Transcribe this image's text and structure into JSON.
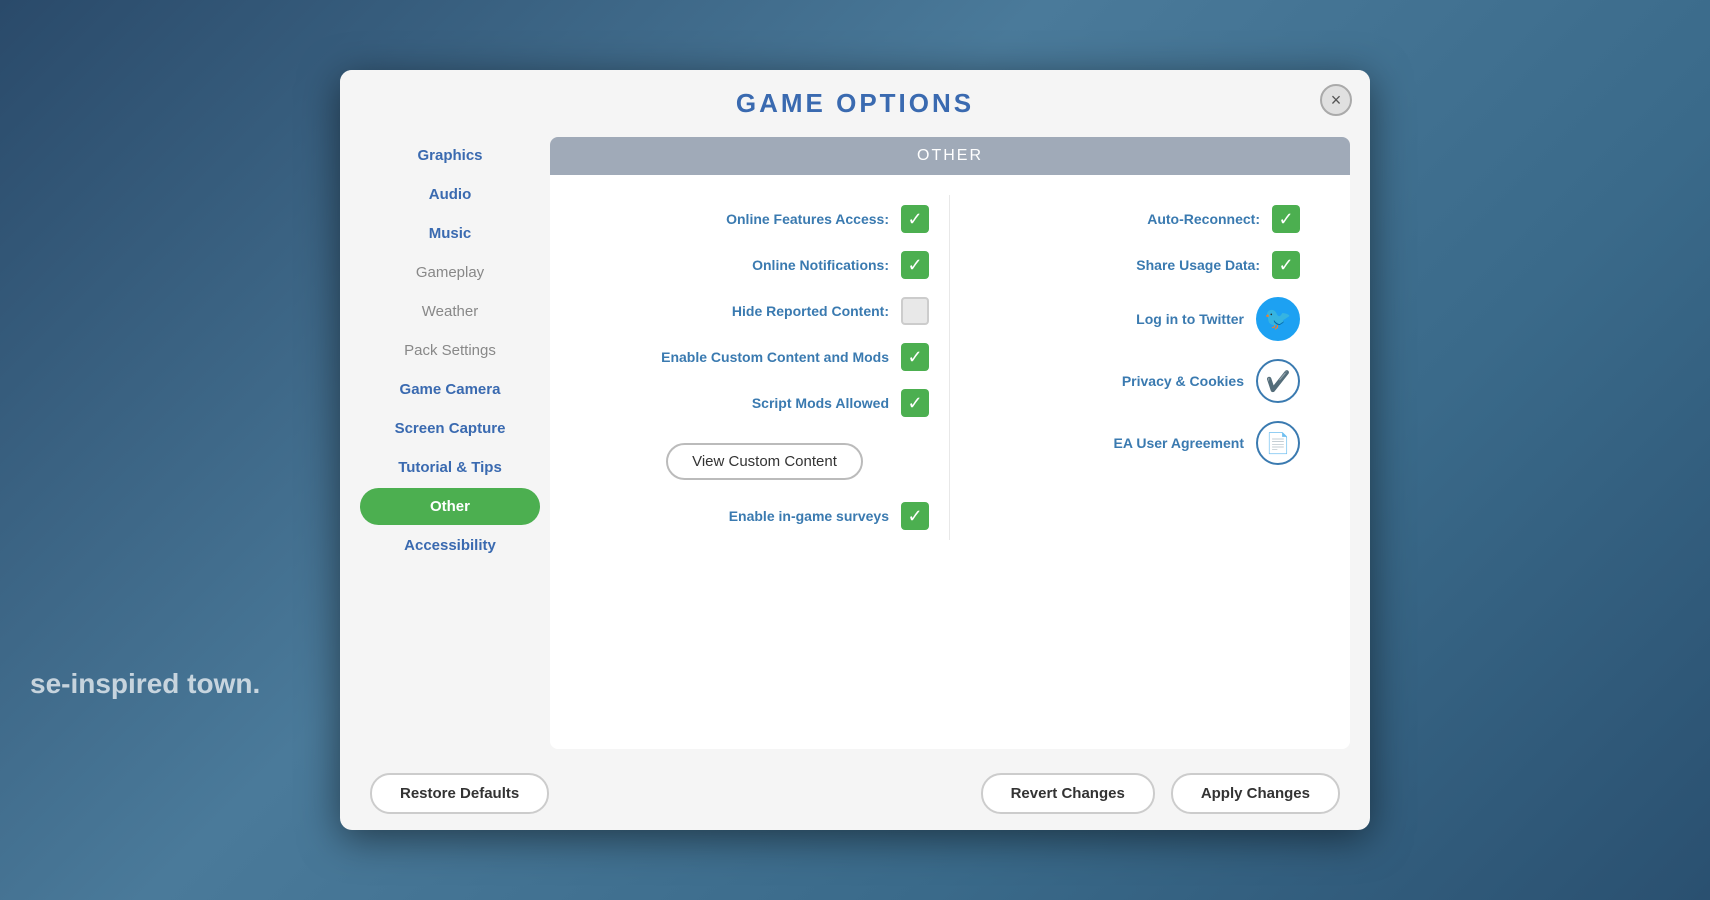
{
  "background": {
    "text": "se-inspired town."
  },
  "modal": {
    "title": "Game Options",
    "close_label": "×"
  },
  "sidebar": {
    "items": [
      {
        "id": "graphics",
        "label": "Graphics",
        "state": "normal"
      },
      {
        "id": "audio",
        "label": "Audio",
        "state": "normal"
      },
      {
        "id": "music",
        "label": "Music",
        "state": "normal"
      },
      {
        "id": "gameplay",
        "label": "Gameplay",
        "state": "inactive"
      },
      {
        "id": "weather",
        "label": "Weather",
        "state": "inactive"
      },
      {
        "id": "pack-settings",
        "label": "Pack Settings",
        "state": "inactive"
      },
      {
        "id": "game-camera",
        "label": "Game Camera",
        "state": "normal"
      },
      {
        "id": "screen-capture",
        "label": "Screen Capture",
        "state": "normal"
      },
      {
        "id": "tutorial-tips",
        "label": "Tutorial & Tips",
        "state": "normal"
      },
      {
        "id": "other",
        "label": "Other",
        "state": "active"
      },
      {
        "id": "accessibility",
        "label": "Accessibility",
        "state": "normal"
      }
    ]
  },
  "content": {
    "header": "Other",
    "left_options": [
      {
        "id": "online-features",
        "label": "Online Features Access:",
        "checked": true,
        "type": "checkbox"
      },
      {
        "id": "online-notifications",
        "label": "Online Notifications:",
        "checked": true,
        "type": "checkbox"
      },
      {
        "id": "hide-reported",
        "label": "Hide Reported Content:",
        "checked": false,
        "type": "checkbox"
      },
      {
        "id": "enable-custom",
        "label": "Enable Custom Content and Mods",
        "checked": true,
        "type": "checkbox"
      },
      {
        "id": "script-mods",
        "label": "Script Mods Allowed",
        "checked": true,
        "type": "checkbox"
      },
      {
        "id": "enable-surveys",
        "label": "Enable in-game surveys",
        "checked": true,
        "type": "checkbox"
      }
    ],
    "view_custom_btn": "View Custom Content",
    "right_options": [
      {
        "id": "auto-reconnect",
        "label": "Auto-Reconnect:",
        "checked": true,
        "type": "checkbox"
      },
      {
        "id": "share-usage",
        "label": "Share Usage Data:",
        "checked": true,
        "type": "checkbox"
      },
      {
        "id": "log-twitter",
        "label": "Log in to Twitter",
        "icon": "twitter",
        "type": "icon"
      },
      {
        "id": "privacy-cookies",
        "label": "Privacy & Cookies",
        "icon": "shield",
        "type": "icon"
      },
      {
        "id": "ea-agreement",
        "label": "EA User Agreement",
        "icon": "doc",
        "type": "icon"
      }
    ]
  },
  "footer": {
    "restore_label": "Restore Defaults",
    "revert_label": "Revert Changes",
    "apply_label": "Apply Changes"
  },
  "icons": {
    "checkmark": "✓",
    "twitter": "🐦",
    "shield": "🛡",
    "doc": "📄"
  }
}
